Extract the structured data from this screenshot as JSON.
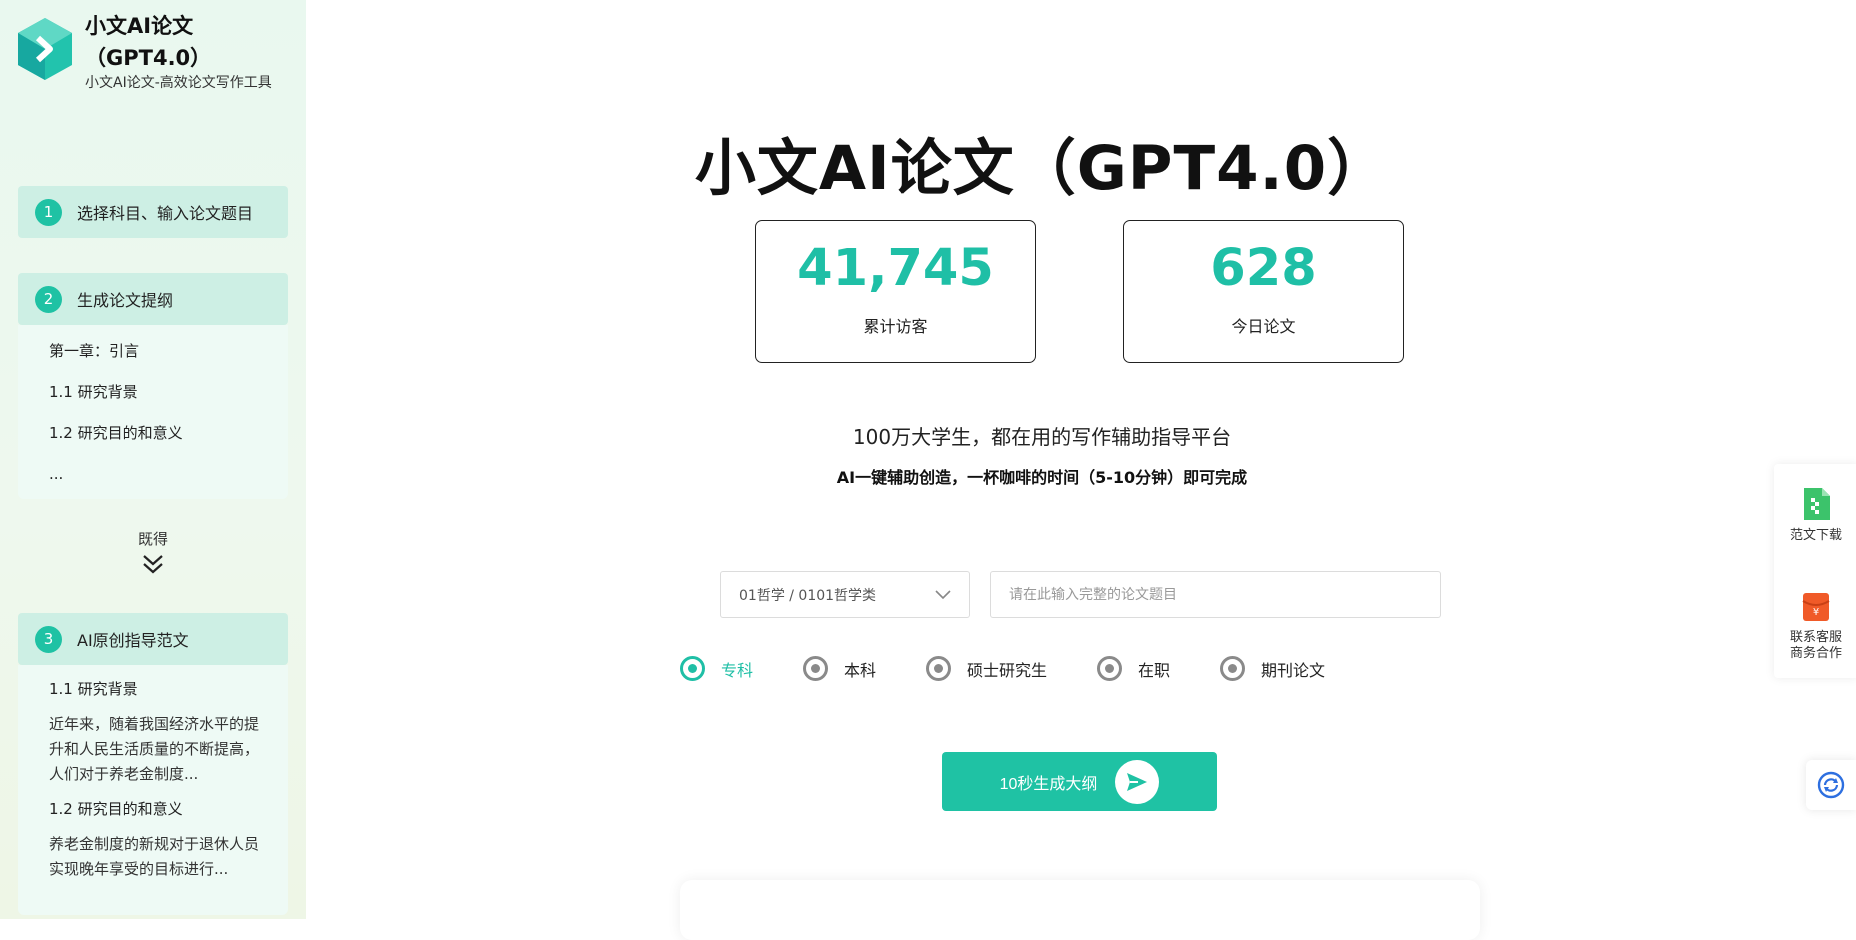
{
  "brand": {
    "title": "小文AI论文（GPT4.0）",
    "subtitle": "小文AI论文-高效论文写作工具"
  },
  "steps": [
    {
      "num": "1",
      "label": "选择科目、输入论文题目"
    },
    {
      "num": "2",
      "label": "生成论文提纲",
      "outline": [
        "第一章：引言",
        "1.1 研究背景",
        "1.2 研究目的和意义",
        "..."
      ]
    },
    {
      "num": "3",
      "label": "AI原创指导范文",
      "paragraphs": [
        {
          "heading": "1.1 研究背景",
          "text": "近年来，随着我国经济水平的提升和人民生活质量的不断提高，人们对于养老金制度..."
        },
        {
          "heading": "1.2 研究目的和意义",
          "text": "养老金制度的新规对于退休人员实现晚年享受的目标进行..."
        }
      ]
    }
  ],
  "expand_hint": "既得",
  "main": {
    "title": "小文AI论文（GPT4.0）",
    "stats": [
      {
        "value": "41,745",
        "label": "累计访客"
      },
      {
        "value": "628",
        "label": "今日论文"
      }
    ],
    "slogan_main": "100万大学生，都在用的写作辅助指导平台",
    "slogan_sub": "AI一键辅助创造，一杯咖啡的时间（5-10分钟）即可完成",
    "subject_select": {
      "value": "01哲学 / 0101哲学类"
    },
    "title_input": {
      "placeholder": "请在此输入完整的论文题目",
      "value": ""
    },
    "levels": [
      {
        "label": "专科",
        "selected": true
      },
      {
        "label": "本科",
        "selected": false
      },
      {
        "label": "硕士研究生",
        "selected": false
      },
      {
        "label": "在职",
        "selected": false
      },
      {
        "label": "期刊论文",
        "selected": false
      }
    ],
    "generate_button": "10秒生成大纲"
  },
  "float_panel": {
    "download_label": "范文下载",
    "service_label_1": "联系客服",
    "service_label_2": "商务合作"
  },
  "colors": {
    "accent": "#1fc2a4",
    "stat_value": "#1fbfa6",
    "step_head_bg": "#cdefe4"
  }
}
